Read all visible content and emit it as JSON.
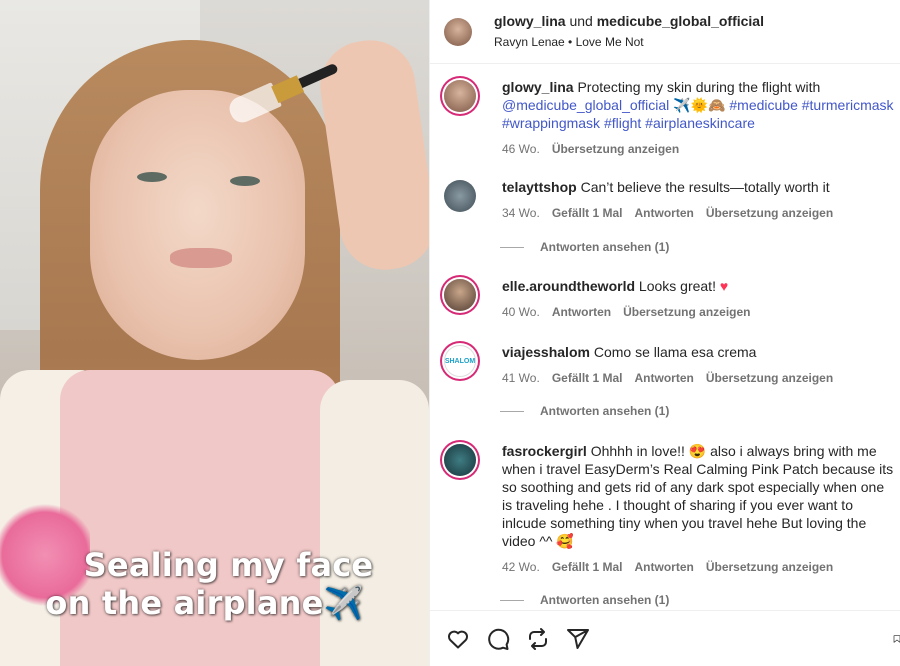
{
  "post": {
    "caption_line1": "Sealing my face",
    "caption_line2": "on the airplane✈️"
  },
  "header": {
    "user1": "glowy_lina",
    "connector": " und ",
    "user2": "medicube_global_official",
    "audio": "Ravyn Lenae • Love Me Not"
  },
  "owner_comment": {
    "username": "glowy_lina",
    "text": "Protecting my skin during the flight with",
    "mention": "@medicube_global_official",
    "emoji": "✈️🌞🙈",
    "hashtags_line1": "#medicube #turmericmask",
    "hashtags_line2": "#wrappingmask #flight #airplaneskincare",
    "age": "46 Wo.",
    "translate": "Übersetzung anzeigen"
  },
  "comments": [
    {
      "username": "telayttshop",
      "text": "Can’t believe the results—totally worth it",
      "age": "34 Wo.",
      "likes": "Gefällt 1 Mal",
      "reply": "Antworten",
      "translate": "Übersetzung anzeigen",
      "view_replies": "Antworten ansehen (1)"
    },
    {
      "username": "elle.aroundtheworld",
      "text": "Looks great!",
      "emoji": "♥",
      "age": "40 Wo.",
      "reply": "Antworten",
      "translate": "Übersetzung anzeigen"
    },
    {
      "username": "viajesshalom",
      "avatar_text": "SHALOM",
      "text": "Como se llama esa crema",
      "age": "41 Wo.",
      "likes": "Gefällt 1 Mal",
      "reply": "Antworten",
      "translate": "Übersetzung anzeigen",
      "view_replies": "Antworten ansehen (1)"
    },
    {
      "username": "fasrockergirl",
      "text_line1": "Ohhhh in love!! 😍  also i always bring with me",
      "text_line2": "when i travel EasyDerm’s Real Calming Pink Patch because its",
      "text_line3": "so soothing and gets rid of any dark spot especially when one",
      "text_line4": "is traveling hehe . I thought of sharing if you ever want to",
      "text_line5": "inlcude something tiny when you travel hehe But loving the",
      "text_line6": "video ^^ 🥰",
      "age": "42 Wo.",
      "likes": "Gefällt 1 Mal",
      "reply": "Antworten",
      "translate": "Übersetzung anzeigen",
      "view_replies": "Antworten ansehen (1)"
    }
  ],
  "actions": {
    "icons": [
      "heart-icon",
      "comment-icon",
      "repost-icon",
      "share-icon",
      "bookmark-icon"
    ]
  },
  "colors": {
    "link": "#4257c8",
    "muted": "#737373",
    "ring": "#d62976",
    "heart": "#ff3355"
  }
}
